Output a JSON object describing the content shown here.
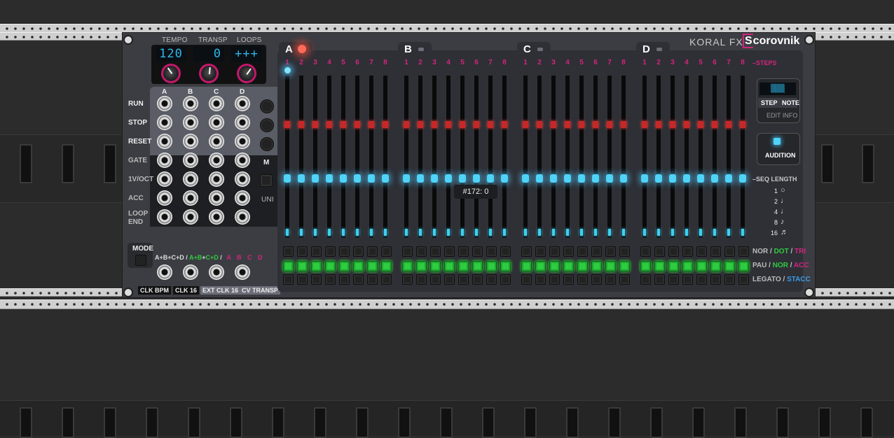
{
  "brand": {
    "maker": "KORAL FX",
    "product_prefix": "S",
    "product_rest": "corovnik"
  },
  "top": {
    "labels": [
      "TEMPO",
      "TRANSP",
      "LOOPS"
    ],
    "displays": [
      "120",
      "0",
      "+++"
    ]
  },
  "columns": [
    "A",
    "B",
    "C",
    "D"
  ],
  "row_labels": [
    "RUN",
    "STOP",
    "RESET",
    "GATE",
    "1V/OCT",
    "ACC",
    "LOOP",
    "END"
  ],
  "side_button_labels": [
    "M",
    "UNI"
  ],
  "mode": {
    "label": "MODE",
    "combo": [
      "A+B+C+D",
      "/",
      "A+B",
      "C+D",
      "/",
      "A",
      "B",
      "C",
      "D"
    ]
  },
  "bottom_tags": [
    "CLK BPM",
    "CLK 16",
    "EXT CLK 16",
    "CV TRANSP"
  ],
  "tracks": [
    "A",
    "B",
    "C",
    "D"
  ],
  "steps": [
    "1",
    "2",
    "3",
    "4",
    "5",
    "6",
    "7",
    "8"
  ],
  "right": {
    "steps_label": "STEPS",
    "seq_length_label": "SEQ LENGTH",
    "step_btn": "STEP",
    "note_btn": "NOTE",
    "edit_info": "EDIT INFO",
    "audition": "AUDITION",
    "lengths": [
      "1",
      "2",
      "4",
      "8",
      "16"
    ],
    "mode_rows": [
      [
        "NOR",
        "/",
        "DOT",
        "/",
        "TRI"
      ],
      [
        "PAU",
        "/",
        "NOR",
        "/",
        "ACC"
      ],
      [
        "LEGATO",
        "/",
        "STACC"
      ]
    ]
  },
  "tooltip": "#172: 0",
  "colors": {
    "accent": "#d4247e",
    "led_blue": "#4fd3f7",
    "led_green": "#2ecc40",
    "panel": "#3b3d42"
  }
}
